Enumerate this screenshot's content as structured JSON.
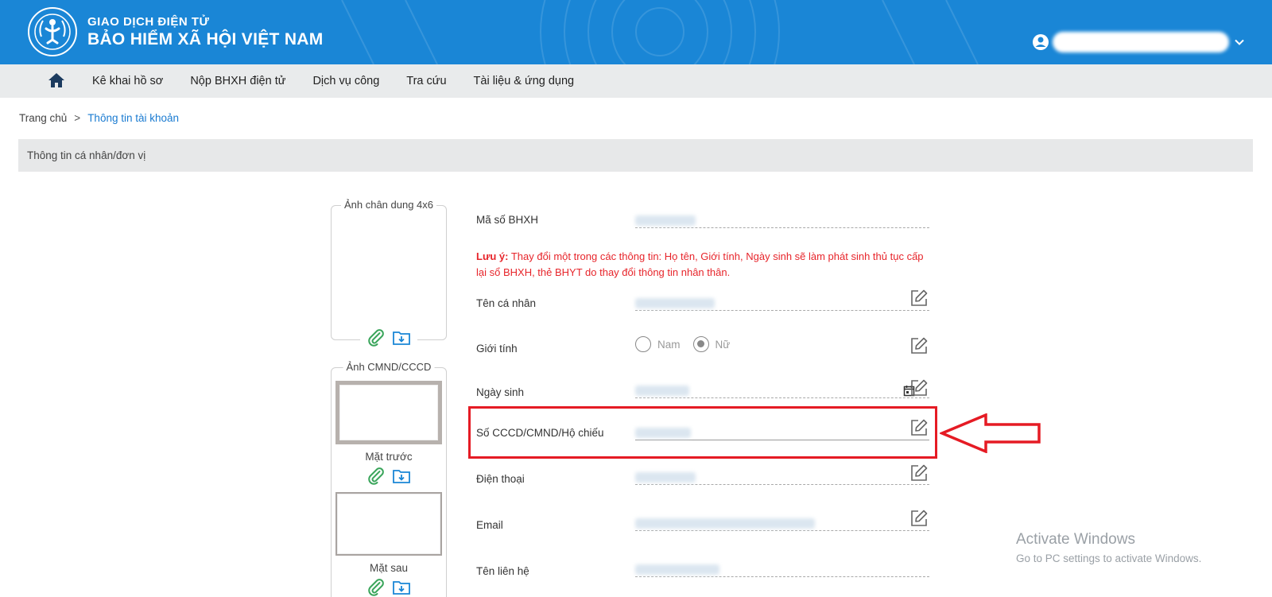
{
  "header": {
    "title_small": "GIAO DỊCH ĐIỆN TỬ",
    "title_large": "BẢO HIỂM XÃ HỘI VIỆT NAM",
    "logo_text": "BẢO HIỂM XÃ HỘI VIỆT NAM",
    "brand_color": "#1a86d6"
  },
  "nav": {
    "items": [
      "Kê khai hồ sơ",
      "Nộp BHXH điện tử",
      "Dịch vụ công",
      "Tra cứu",
      "Tài liệu & ứng dụng"
    ]
  },
  "breadcrumb": {
    "home": "Trang chủ",
    "separator": ">",
    "current": "Thông tin tài khoản"
  },
  "section": {
    "title": "Thông tin cá nhân/đơn vị"
  },
  "photos": {
    "portrait_label": "Ảnh chân dung 4x6",
    "id_label": "Ảnh CMND/CCCD",
    "front_label": "Mặt trước",
    "back_label": "Mặt sau"
  },
  "form": {
    "ma_so_label": "Mã số BHXH",
    "note_prefix": "Lưu ý:",
    "note_text": " Thay đổi một trong các thông tin: Họ tên, Giới tính, Ngày sinh sẽ làm phát sinh thủ tục cấp lại sổ BHXH, thẻ BHYT do thay đổi thông tin nhân thân.",
    "name_label": "Tên cá nhân",
    "gender_label": "Giới tính",
    "gender_male": "Nam",
    "gender_female": "Nữ",
    "gender_selected": "Nữ",
    "dob_label": "Ngày sinh",
    "id_number_label": "Số CCCD/CMND/Hộ chiếu",
    "phone_label": "Điện thoại",
    "email_label": "Email",
    "contact_label": "Tên liên hệ"
  },
  "annotation": {
    "highlight_color": "#e51b24"
  },
  "watermark": {
    "title": "Activate Windows",
    "subtitle": "Go to PC settings to activate Windows."
  }
}
